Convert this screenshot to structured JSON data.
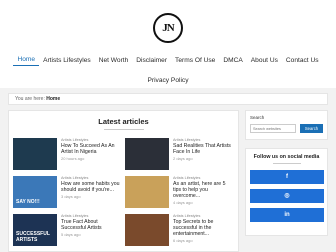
{
  "logo": {
    "icon": "jn-logo",
    "text": "JN"
  },
  "nav": {
    "row1": [
      "Home",
      "Artists Lifestyles",
      "Net Worth",
      "Disclaimer",
      "Terms Of Use",
      "DMCA",
      "About Us",
      "Contact Us"
    ],
    "row2": [
      "Privacy Policy"
    ],
    "active": "Home"
  },
  "breadcrumb": {
    "prefix": "You are here:",
    "current": "Home"
  },
  "latest": {
    "title": "Latest articles",
    "articles": [
      {
        "category": "Artists Lifestyles",
        "title": "How To Succeed As An Artist In Nigeria",
        "date": "20 hours ago",
        "thumb_color": "#1e3a4f",
        "thumb_text": ""
      },
      {
        "category": "Artists Lifestyles",
        "title": "Sad Realities That Artists Face In Life",
        "date": "2 days ago",
        "thumb_color": "#2b2f38",
        "thumb_text": ""
      },
      {
        "category": "Artists Lifestyles",
        "title": "How are some habits you should avoid if you're...",
        "date": "3 days ago",
        "thumb_color": "#3b78b8",
        "thumb_text": "SAY NO!!!"
      },
      {
        "category": "Artists Lifestyles",
        "title": "As an artist, here are 5 tips to help you overcome...",
        "date": "4 days ago",
        "thumb_color": "#c9a15a",
        "thumb_text": ""
      },
      {
        "category": "Artists Lifestyles",
        "title": "True Fact About Successful Artists",
        "date": "5 days ago",
        "thumb_color": "#1d3354",
        "thumb_text": "SUCCESSFUL ARTISTS"
      },
      {
        "category": "Artists Lifestyles",
        "title": "Top Secrets to be successful in the entertainment...",
        "date": "6 days ago",
        "thumb_color": "#7a4a2c",
        "thumb_text": ""
      }
    ]
  },
  "sidebar": {
    "search_label": "Search",
    "search_placeholder": "Search websites",
    "search_button": "Search",
    "social_title": "Follow us on social media",
    "social": [
      {
        "icon": "facebook-icon",
        "glyph": "f"
      },
      {
        "icon": "instagram-icon",
        "glyph": "◎"
      },
      {
        "icon": "linkedin-icon",
        "glyph": "in"
      }
    ]
  },
  "colors": {
    "accent": "#1a6fb5",
    "social": "#1f6fd6",
    "background": "#f2f2f2"
  }
}
